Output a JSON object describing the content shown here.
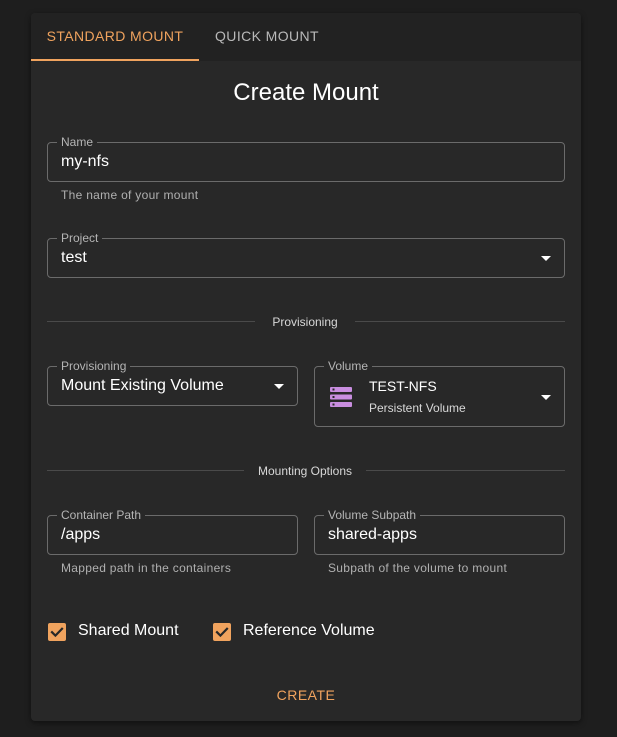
{
  "tabs": [
    {
      "label": "STANDARD MOUNT",
      "active": true
    },
    {
      "label": "QUICK MOUNT",
      "active": false
    }
  ],
  "form": {
    "title": "Create Mount",
    "name": {
      "label": "Name",
      "value": "my-nfs",
      "helper": "The name of your mount"
    },
    "project": {
      "label": "Project",
      "value": "test"
    },
    "provisioning_divider": "Provisioning",
    "provisioning": {
      "label": "Provisioning",
      "value": "Mount Existing Volume"
    },
    "volume": {
      "label": "Volume",
      "value": "TEST-NFS",
      "subtitle": "Persistent Volume",
      "icon": "storage-icon"
    },
    "mounting_divider": "Mounting Options",
    "container_path": {
      "label": "Container Path",
      "value": "/apps",
      "helper": "Mapped path in the containers"
    },
    "volume_subpath": {
      "label": "Volume Subpath",
      "value": "shared-apps",
      "helper": "Subpath of the volume to mount"
    },
    "checkboxes": [
      {
        "label": "Shared Mount",
        "checked": true
      },
      {
        "label": "Reference Volume",
        "checked": true
      }
    ],
    "submit_label": "CREATE"
  },
  "colors": {
    "accent": "#f0a35e",
    "volume_icon": "#c98ee0",
    "background": "#1e1e1e",
    "panel": "#282828"
  }
}
